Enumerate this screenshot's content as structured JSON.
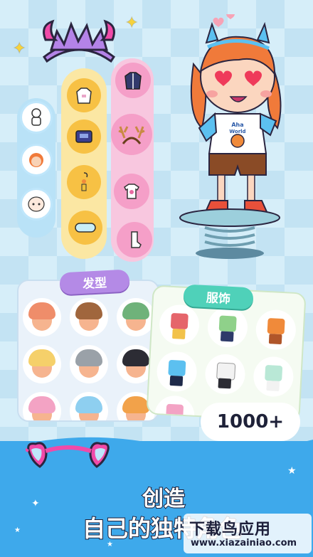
{
  "hair_panel": {
    "title": "发型"
  },
  "clothes_panel": {
    "title": "服饰"
  },
  "count_badge": "1000+",
  "banner": {
    "line1": "创造",
    "line2": "自己的独特角色"
  },
  "watermark": {
    "main": "下载鸟应用",
    "url": "www.xiazainiao.com"
  },
  "character_shirt": {
    "line1": "Aha",
    "line2": "World"
  },
  "colors": {
    "hair_purple": "#b48ae6",
    "clothes_teal": "#4fd1b9",
    "banner_blue": "#3ea9eb",
    "column_blue": "#b9e2f7",
    "column_yellow": "#fbe7a3",
    "column_pink": "#f8c7df"
  },
  "categories": {
    "blue": [
      "body-icon",
      "hair-icon",
      "face-icon"
    ],
    "yellow": [
      "hoodie-icon",
      "backpack-icon",
      "earring-icon",
      "goggles-icon"
    ],
    "pink": [
      "jacket-icon",
      "antlers-icon",
      "tshirt-icon",
      "sock-icon"
    ]
  }
}
